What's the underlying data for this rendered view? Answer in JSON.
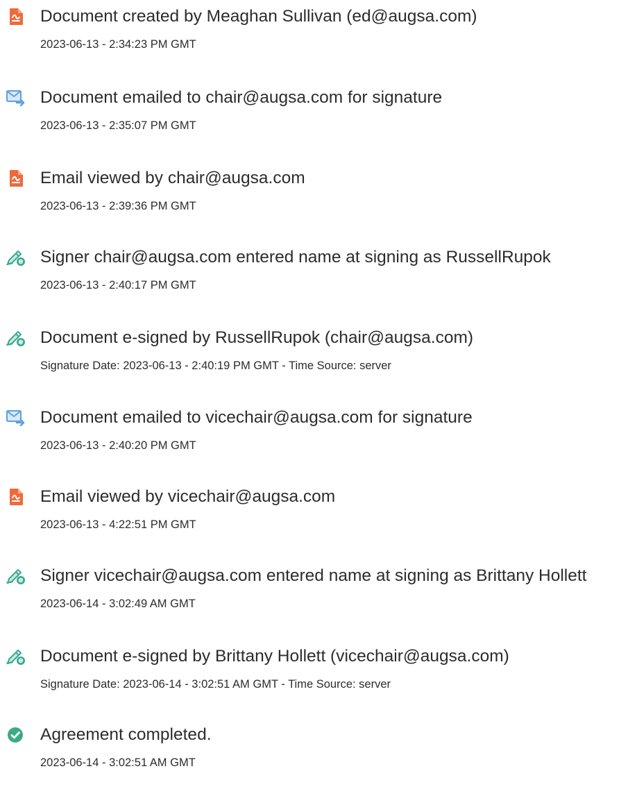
{
  "colors": {
    "document_icon": "#ee6a3d",
    "email_icon": "#5fa0d8",
    "signature_icon": "#3aa892",
    "completed_icon": "#3bab84",
    "text": "#2c2c2c"
  },
  "events": [
    {
      "icon": "document-icon",
      "title": "Document created by Meaghan Sullivan (ed@augsa.com)",
      "detail": "2023-06-13 - 2:34:23 PM GMT"
    },
    {
      "icon": "email-sent-icon",
      "title": "Document emailed to chair@augsa.com for signature",
      "detail": "2023-06-13 - 2:35:07 PM GMT"
    },
    {
      "icon": "document-icon",
      "title": "Email viewed by chair@augsa.com",
      "detail": "2023-06-13 - 2:39:36 PM GMT"
    },
    {
      "icon": "signature-pen-icon",
      "title": "Signer chair@augsa.com entered name at signing as RussellRupok",
      "detail": "2023-06-13 - 2:40:17 PM GMT"
    },
    {
      "icon": "signature-pen-icon",
      "title": "Document e-signed by RussellRupok (chair@augsa.com)",
      "detail": "Signature Date: 2023-06-13 - 2:40:19 PM GMT - Time Source: server"
    },
    {
      "icon": "email-sent-icon",
      "title": "Document emailed to vicechair@augsa.com for signature",
      "detail": "2023-06-13 - 2:40:20 PM GMT"
    },
    {
      "icon": "document-icon",
      "title": "Email viewed by vicechair@augsa.com",
      "detail": "2023-06-13 - 4:22:51 PM GMT"
    },
    {
      "icon": "signature-pen-icon",
      "title": "Signer vicechair@augsa.com entered name at signing as Brittany Hollett",
      "detail": "2023-06-14 - 3:02:49 AM GMT"
    },
    {
      "icon": "signature-pen-icon",
      "title": "Document e-signed by Brittany Hollett (vicechair@augsa.com)",
      "detail": "Signature Date: 2023-06-14 - 3:02:51 AM GMT - Time Source: server"
    },
    {
      "icon": "checkmark-circle-icon",
      "title": "Agreement completed.",
      "detail": "2023-06-14 - 3:02:51 AM GMT"
    }
  ]
}
